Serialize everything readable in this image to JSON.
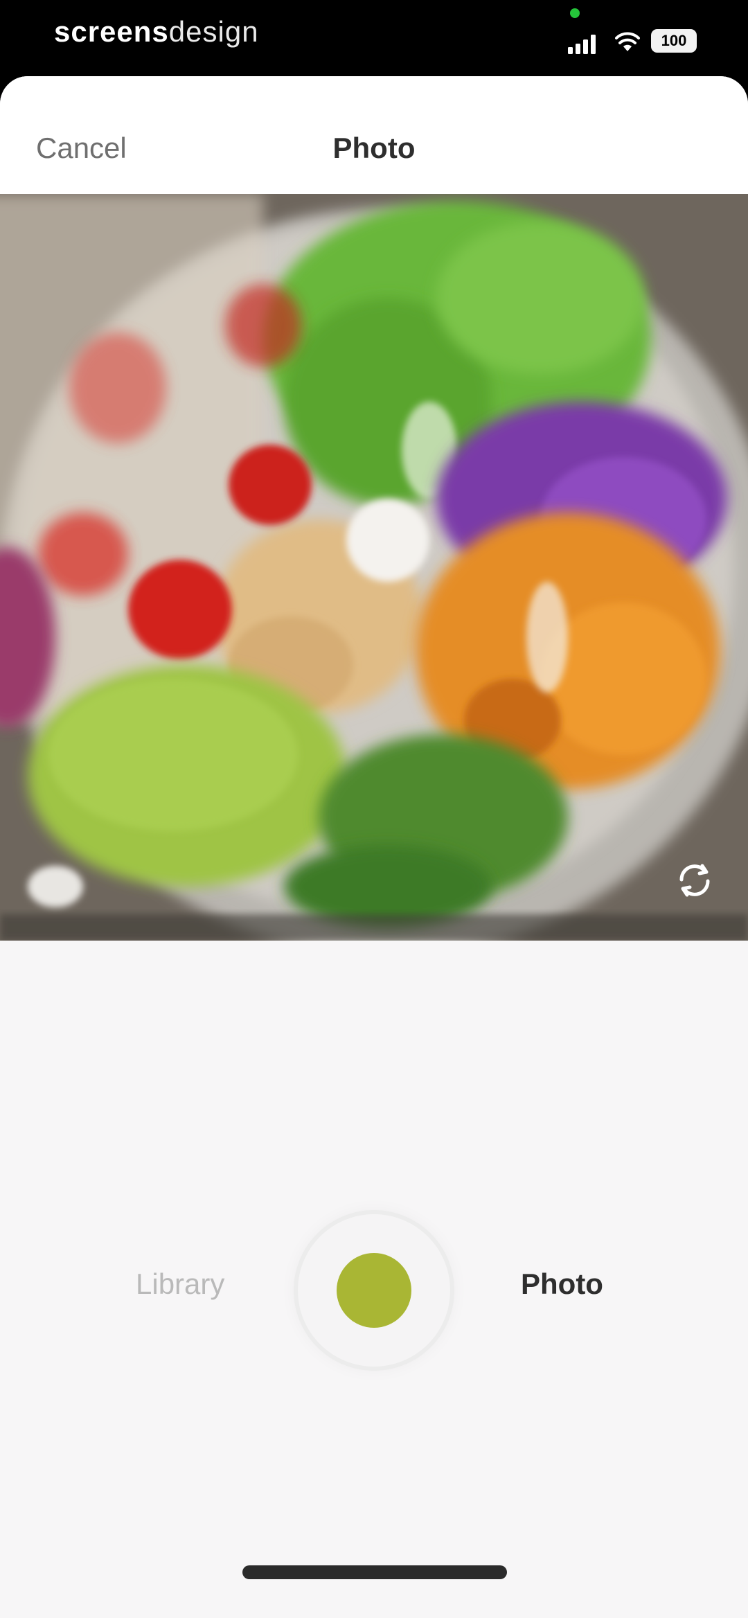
{
  "status_bar": {
    "carrier_bold": "screens",
    "carrier_light": "design",
    "battery": "100"
  },
  "header": {
    "cancel_label": "Cancel",
    "title": "Photo"
  },
  "camera": {
    "preview_subject": "salad-bowl",
    "flip_icon": "flip-camera-icon"
  },
  "shutter": {
    "color": "#a9b634"
  },
  "tabs": {
    "library_label": "Library",
    "photo_label": "Photo",
    "active": "Photo"
  }
}
